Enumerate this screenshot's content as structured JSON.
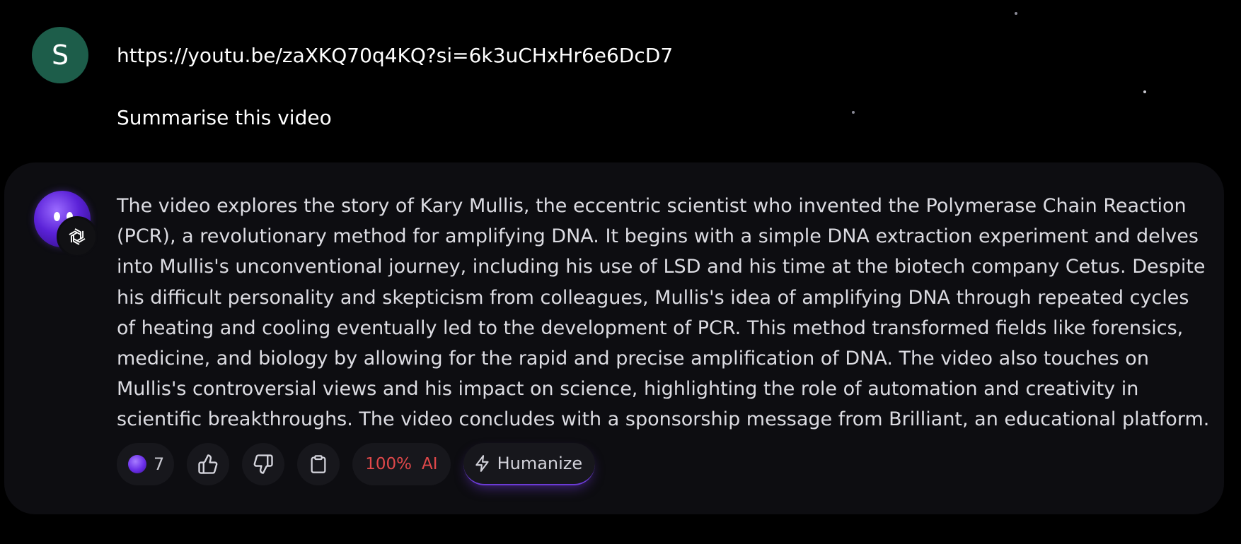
{
  "user_message": {
    "avatar_letter": "S",
    "avatar_color": "#1d5d4a",
    "url": "https://youtu.be/zaXKQ70q4KQ?si=6k3uCHxHr6e6DcD7",
    "prompt": "Summarise this video"
  },
  "assistant_message": {
    "avatar_icon": "purple-orb-avatar-icon",
    "model_icon": "openai-logo-icon",
    "text": "The video explores the story of Kary Mullis, the eccentric scientist who invented the Polymerase Chain Reaction (PCR), a revolutionary method for amplifying DNA. It begins with a simple DNA extraction experiment and delves into Mullis's unconventional journey, including his use of LSD and his time at the biotech company Cetus. Despite his difficult personality and skepticism from colleagues, Mullis's idea of amplifying DNA through repeated cycles of heating and cooling eventually led to the development of PCR. This method transformed fields like forensics, medicine, and biology by allowing for the rapid and precise amplification of DNA. The video also touches on Mullis's controversial views and his impact on science, highlighting the role of automation and creativity in scientific breakthroughs. The video concludes with a sponsorship message from Brilliant, an educational platform."
  },
  "actions": {
    "credits_count": "7",
    "like_icon": "thumbs-up-icon",
    "dislike_icon": "thumbs-down-icon",
    "copy_icon": "clipboard-icon",
    "ai_percent": "100%",
    "ai_label": "AI",
    "ai_color": "#e0484a",
    "humanize_icon": "lightning-bolt-icon",
    "humanize_label": "Humanize"
  },
  "colors": {
    "background": "#000000",
    "card": "#0d0d11",
    "pill": "#17171c",
    "accent": "#6b3bd6"
  }
}
